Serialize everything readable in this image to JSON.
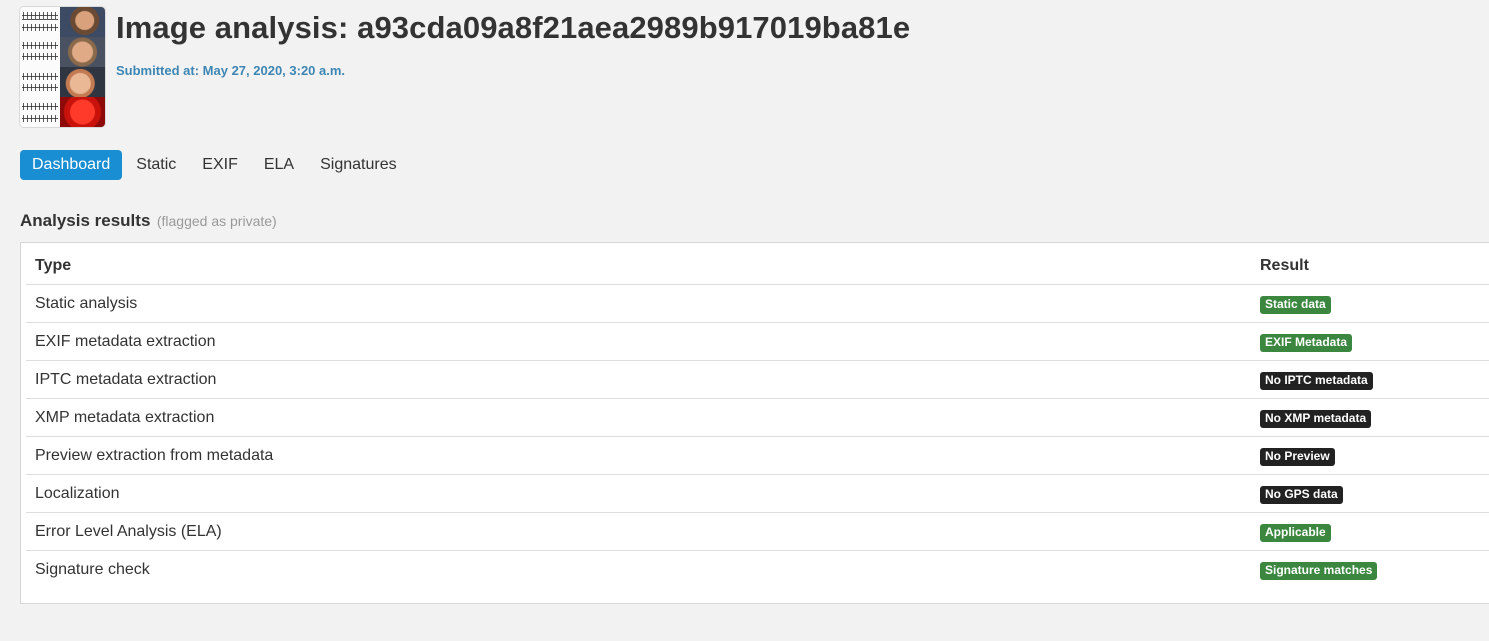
{
  "header": {
    "title": "Image analysis: a93cda09a8f21aea2989b917019ba81e",
    "submitted": "Submitted at: May 27, 2020, 3:20 a.m.",
    "thumbnail_icon": "image-thumbnail-icon"
  },
  "tabs": [
    {
      "label": "Dashboard",
      "active": true
    },
    {
      "label": "Static",
      "active": false
    },
    {
      "label": "EXIF",
      "active": false
    },
    {
      "label": "ELA",
      "active": false
    },
    {
      "label": "Signatures",
      "active": false
    }
  ],
  "section": {
    "title": "Analysis results",
    "note": "(flagged as private)"
  },
  "table": {
    "headers": {
      "type": "Type",
      "result": "Result"
    },
    "rows": [
      {
        "type": "Static analysis",
        "result": "Static data",
        "status": "green"
      },
      {
        "type": "EXIF metadata extraction",
        "result": "EXIF Metadata",
        "status": "green"
      },
      {
        "type": "IPTC metadata extraction",
        "result": "No IPTC metadata",
        "status": "dark"
      },
      {
        "type": "XMP metadata extraction",
        "result": "No XMP metadata",
        "status": "dark"
      },
      {
        "type": "Preview extraction from metadata",
        "result": "No Preview",
        "status": "dark"
      },
      {
        "type": "Localization",
        "result": "No GPS data",
        "status": "dark"
      },
      {
        "type": "Error Level Analysis (ELA)",
        "result": "Applicable",
        "status": "green"
      },
      {
        "type": "Signature check",
        "result": "Signature matches",
        "status": "green"
      }
    ]
  },
  "colors": {
    "accent": "#1a8ed3",
    "submitted": "#3d86b4",
    "badge_green": "#3b873f",
    "badge_dark": "#222222"
  }
}
